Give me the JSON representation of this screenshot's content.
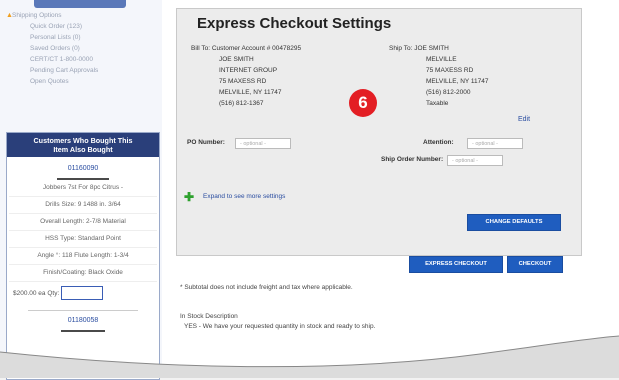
{
  "left_nav": {
    "items": [
      {
        "label": "Shipping Options",
        "bullet": true
      },
      {
        "label": "Quick Order (123)",
        "bullet": false
      },
      {
        "label": "Personal Lists (0)",
        "bullet": false
      },
      {
        "label": "Saved Orders (0)",
        "bullet": false
      },
      {
        "label": "CERT/CT 1-800-0000",
        "bullet": false
      },
      {
        "label": "Pending Cart Approvals",
        "bullet": false
      },
      {
        "label": "Open Quotes",
        "bullet": false
      }
    ]
  },
  "cwb": {
    "heading_line1": "Customers Who Bought This",
    "heading_line2": "Item Also Bought",
    "item1": "01160090",
    "specs": [
      "Jobbers 7st For 8pc Citrus -",
      "Drills Size: 9 1488 in. 3/64",
      "Overall Length: 2-7/8 Material",
      "HSS Type: Standard Point",
      "Angle °: 118 Flute Length: 1-3/4",
      "Finish/Coating: Black Oxide"
    ],
    "price": "$200.00 ea",
    "qty_label": "Qty:",
    "item2": "01180058"
  },
  "settings": {
    "title": "Express Checkout Settings",
    "bill_to_label": "Bill To:",
    "bill_to": [
      "Customer Account # 00478295",
      "JOE SMITH",
      "INTERNET GROUP",
      "75 MAXESS RD",
      "MELVILLE, NY 11747",
      "(516) 812-1367"
    ],
    "ship_to_label": "Ship To:",
    "ship_to": [
      "JOE SMITH",
      "MELVILLE",
      "75 MAXESS RD",
      "MELVILLE, NY 11747",
      "(516) 812-2000",
      "Taxable"
    ],
    "edit_label": "Edit",
    "badge": "6",
    "po_label": "PO Number:",
    "po_placeholder": "- optional -",
    "attention_label": "Attention:",
    "attention_placeholder": "- optional -",
    "ship_order_label": "Ship Order Number:",
    "ship_order_placeholder": "- optional -",
    "expand_label": "Expand to see more settings",
    "change_defaults_label": "CHANGE DEFAULTS"
  },
  "actions": {
    "express_checkout_label": "EXPRESS CHECKOUT",
    "checkout_label": "CHECKOUT"
  },
  "notes": {
    "subtotal_note": "* Subtotal does not include freight and tax where applicable.",
    "in_stock_title": "In Stock Description",
    "in_stock_text": "YES - We have your requested quantity in stock and ready to ship."
  },
  "colors": {
    "accent": "#1f5dbf",
    "nav_header": "#2a3f7a",
    "badge": "#e31e24",
    "link": "#2a4da0"
  }
}
